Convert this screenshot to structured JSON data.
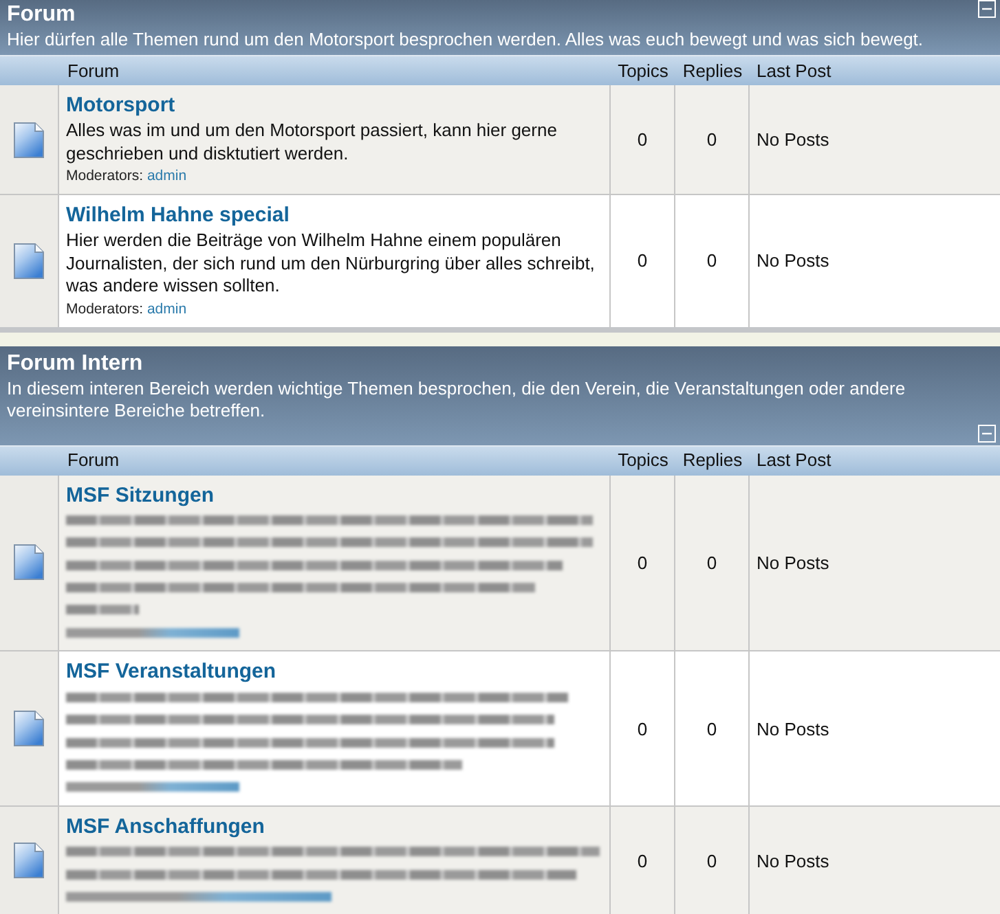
{
  "sections": [
    {
      "title": "Forum",
      "description": "Hier dürfen alle Themen rund um den Motorsport besprochen werden. Alles was euch bewegt und was sich bewegt.",
      "expanded": true,
      "columns": [
        "Forum",
        "Topics",
        "Replies",
        "Last Post"
      ],
      "forums": [
        {
          "name": "Motorsport",
          "description": "Alles was im und um den Motorsport passiert, kann hier gerne geschrieben und disktutiert werden.",
          "moderators_label": "Moderators:",
          "moderators": [
            "admin"
          ],
          "topics": "0",
          "replies": "0",
          "last_post": "No Posts"
        },
        {
          "name": "Wilhelm Hahne special",
          "description": "Hier werden die Beiträge von Wilhelm Hahne einem populären Journalisten, der sich rund um den Nürburgring über alles schreibt, was andere wissen sollten.",
          "moderators_label": "Moderators:",
          "moderators": [
            "admin"
          ],
          "topics": "0",
          "replies": "0",
          "last_post": "No Posts"
        }
      ]
    },
    {
      "title": "Forum Intern",
      "description": "In diesem interen Bereich werden wichtige Themen besprochen, die den Verein, die Veranstaltungen oder andere vereinsintere Bereiche betreffen.",
      "expanded": true,
      "columns": [
        "Forum",
        "Topics",
        "Replies",
        "Last Post"
      ],
      "forums": [
        {
          "name": "MSF Sitzungen",
          "blurred_lines": [
            {
              "kind": "text"
            },
            {
              "kind": "text"
            },
            {
              "kind": "text"
            },
            {
              "kind": "text"
            },
            {
              "kind": "text"
            },
            {
              "kind": "moderators"
            }
          ],
          "topics": "0",
          "replies": "0",
          "last_post": "No Posts"
        },
        {
          "name": "MSF Veranstaltungen",
          "blurred_lines": [
            {
              "kind": "text"
            },
            {
              "kind": "text"
            },
            {
              "kind": "text"
            },
            {
              "kind": "text"
            },
            {
              "kind": "moderators"
            }
          ],
          "topics": "0",
          "replies": "0",
          "last_post": "No Posts"
        },
        {
          "name": "MSF Anschaffungen",
          "blurred_lines": [
            {
              "kind": "text"
            },
            {
              "kind": "text"
            },
            {
              "kind": "moderators"
            }
          ],
          "topics": "0",
          "replies": "0",
          "last_post": "No Posts"
        }
      ]
    }
  ]
}
